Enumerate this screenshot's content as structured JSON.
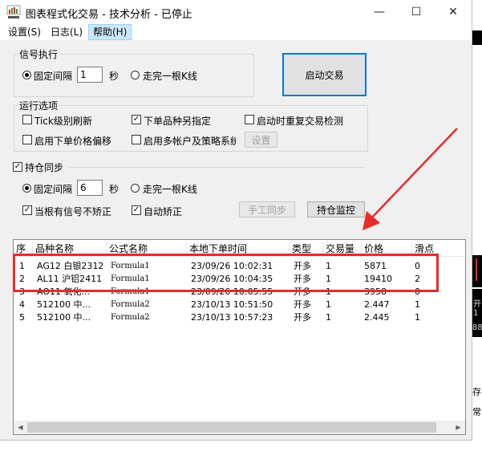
{
  "window": {
    "title": "图表程式化交易 - 技术分析 - 已停止",
    "controls": {
      "minimize": "—",
      "maximize": "☐",
      "close": "✕"
    }
  },
  "menu": [
    "设置(S)",
    "日志(L)",
    "帮助(H)"
  ],
  "signal_exec": {
    "title": "信号执行",
    "fixed_interval_label": "固定间隔",
    "interval_value": "1",
    "seconds_label": "秒",
    "walk_bar_label": "走完一根K线",
    "mode_selected": "fixed"
  },
  "start_button": "启动交易",
  "run_options": {
    "title": "运行选项",
    "tick_refresh": {
      "label": "Tick级别刷新",
      "checked": false
    },
    "order_symbol": {
      "label": "下单品种另指定",
      "checked": true
    },
    "repeat_check": {
      "label": "启动时重复交易检测",
      "checked": false
    },
    "price_offset": {
      "label": "启用下单价格偏移",
      "checked": false
    },
    "multi_account": {
      "label": "启用多帐户及策略系统",
      "checked": false
    },
    "settings_button": "设置"
  },
  "position_sync": {
    "label": "持仓同步",
    "checked": true,
    "fixed_interval_label": "固定间隔",
    "interval_value": "6",
    "seconds_label": "秒",
    "walk_bar_label": "走完一根K线",
    "no_signal_label": "当根有信号不矫正",
    "no_signal_checked": true,
    "auto_correct_label": "自动矫正",
    "auto_correct_checked": true,
    "manual_sync_button": "手工同步",
    "monitor_button": "持仓监控"
  },
  "table": {
    "columns": [
      "序",
      "品种名称",
      "公式名称",
      "本地下单时间",
      "类型",
      "交易量",
      "价格",
      "滑点"
    ],
    "rows": [
      [
        "1",
        "AG12 白银2312",
        "Formula1",
        "23/09/26 10:02:31",
        "开多",
        "1",
        "5871",
        "0"
      ],
      [
        "2",
        "AL11 沪铝2411",
        "Formula1",
        "23/09/26 10:04:35",
        "开多",
        "1",
        "19410",
        "2"
      ],
      [
        "3",
        "AO11 氧化...",
        "Formula1",
        "23/09/26 10:05:55",
        "开多",
        "1",
        "3958",
        "0"
      ],
      [
        "4",
        "512100 中...",
        "Formula2",
        "23/10/13 10:51:50",
        "开多",
        "1",
        "2.447",
        "1"
      ],
      [
        "5",
        "512100 中...",
        "Formula2",
        "23/10/13 10:57:23",
        "开多",
        "1",
        "2.445",
        "1"
      ]
    ]
  },
  "right_strip": {
    "a": "开",
    "b": "1",
    "c": "88",
    "d": "存",
    "e": "常"
  }
}
